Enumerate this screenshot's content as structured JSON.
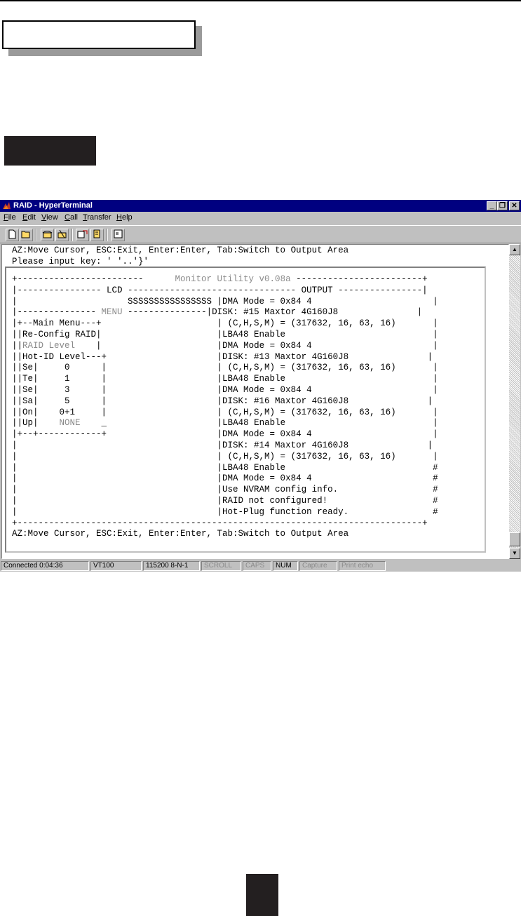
{
  "window": {
    "title": "RAID - HyperTerminal",
    "controls": {
      "minimize": "_",
      "restore": "❐",
      "close": "✕"
    }
  },
  "menu": [
    "File",
    "Edit",
    "View",
    "Call",
    "Transfer",
    "Help"
  ],
  "toolbar_icons": [
    "new-icon",
    "open-icon",
    "phone-icon",
    "disconnect-icon",
    "send-icon",
    "receive-icon",
    "properties-icon"
  ],
  "terminal": {
    "help_line": "AZ:Move Cursor, ESC:Exit, Enter:Enter, Tab:Switch to Output Area",
    "prompt_line": "Please input key: ' '..'}'",
    "screen": {
      "header_left": "+------------------------",
      "header_title": "      Monitor Utility v0.08a ",
      "header_right": "------------------------+",
      "lcd_row": "|---------------- LCD -------------------------------- OUTPUT ----------------|",
      "lcd_value_row": "|                     SSSSSSSSSSSSSSSS |DMA Mode = 0x84 4                       |",
      "menu_row_a": "|--------------- ",
      "menu_label": "MENU",
      "menu_row_b": " ---------------|DISK: #15 Maxtor 4G160J8               |",
      "rows": [
        "|+--Main Menu---+                      | (C,H,S,M) = (317632, 16, 63, 16)       |",
        "||Re-Config RAID|                      |LBA48 Enable                            |"
      ],
      "raid_level_a": "||",
      "raid_level_label": "RAID Level",
      "raid_level_b": "    |                      |DMA Mode = 0x84 4                       |",
      "rows2": [
        "||Hot-ID Level---+                     |DISK: #13 Maxtor 4G160J8               |",
        "||Se|     0      |                     | (C,H,S,M) = (317632, 16, 63, 16)       |",
        "||Te|     1      |                     |LBA48 Enable                            |",
        "||Se|     3      |                     |DMA Mode = 0x84 4                       |",
        "||Sa|     5      |                     |DISK: #16 Maxtor 4G160J8               |",
        "||On|    0+1     |                     | (C,H,S,M) = (317632, 16, 63, 16)       |"
      ],
      "up_row_a": "||Up|    ",
      "up_value": "NONE",
      "up_row_b": "    _                     |LBA48 Enable                            |",
      "rows3": [
        "|+--+------------+                     |DMA Mode = 0x84 4                       |",
        "|                                      |DISK: #14 Maxtor 4G160J8               |",
        "|                                      | (C,H,S,M) = (317632, 16, 63, 16)       |",
        "|                                      |LBA48 Enable                            #",
        "|                                      |DMA Mode = 0x84 4                       #",
        "|                                      |Use NVRAM config info.                  #",
        "|                                      |RAID not configured!                    #",
        "|                                      |Hot-Plug function ready.                #",
        "+-----------------------------------------------------------------------------+",
        "AZ:Move Cursor, ESC:Exit, Enter:Enter, Tab:Switch to Output Area"
      ]
    }
  },
  "statusbar": {
    "connected": "Connected 0:04:36",
    "emulation": "VT100",
    "port": "115200 8-N-1",
    "scroll": "SCROLL",
    "caps": "CAPS",
    "num": "NUM",
    "capture": "Capture",
    "print_echo": "Print echo"
  }
}
